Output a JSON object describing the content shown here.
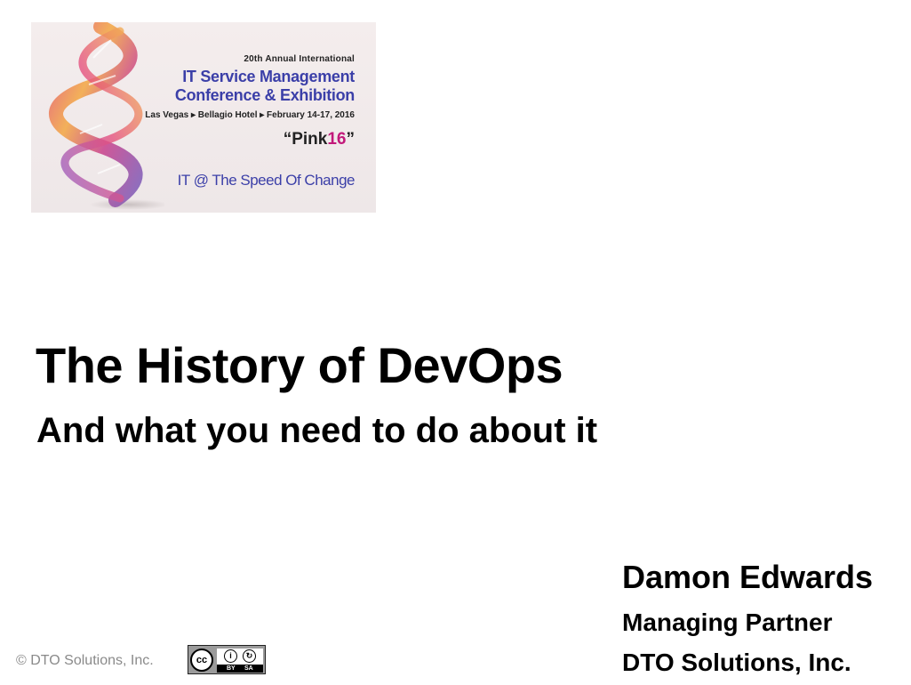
{
  "banner": {
    "annual": "20th Annual International",
    "name_line1": "IT Service Management",
    "name_line2": "Conference & Exhibition",
    "location": "Las Vegas ▸ Bellagio Hotel ▸ February 14-17, 2016",
    "event_prefix": "“Pink",
    "event_highlight": "16",
    "event_suffix": "”",
    "tagline": "IT @ The Speed Of Change",
    "colors": {
      "primary": "#3b3fa8",
      "highlight": "#c2187a"
    }
  },
  "slide": {
    "title": "The History of DevOps",
    "subtitle": "And what you need to do about it"
  },
  "presenter": {
    "name": "Damon Edwards",
    "role": "Managing Partner",
    "company": "DTO Solutions, Inc."
  },
  "footer": {
    "copyright": "© DTO Solutions, Inc."
  },
  "license": {
    "cc_label": "cc",
    "by_label": "BY",
    "sa_label": "SA",
    "icons": [
      "cc-icon",
      "attribution-icon",
      "share-alike-icon"
    ]
  }
}
